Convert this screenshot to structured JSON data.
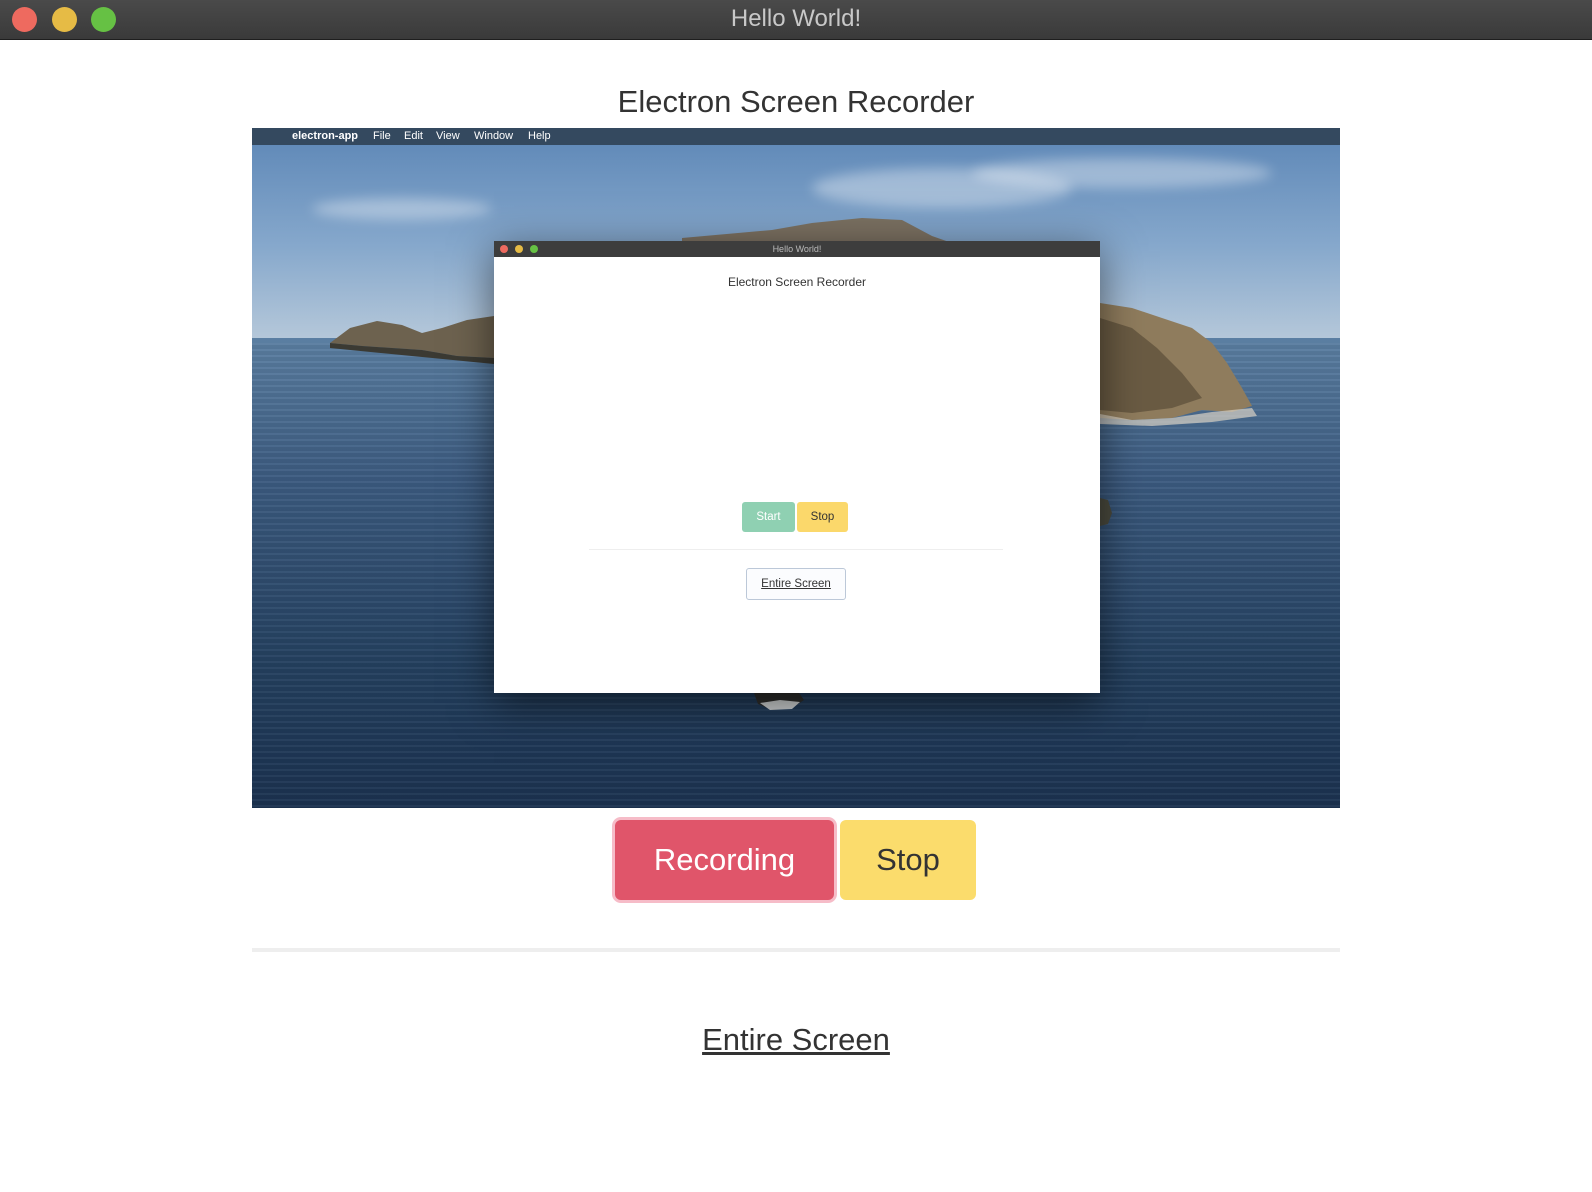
{
  "window": {
    "title": "Hello World!"
  },
  "page": {
    "title": "Electron Screen Recorder"
  },
  "preview": {
    "menubar": {
      "apple_glyph": "",
      "app_name": "electron-app",
      "items": [
        "File",
        "Edit",
        "View",
        "Window",
        "Help"
      ]
    },
    "inner_window": {
      "title": "Hello World!",
      "heading": "Electron Screen Recorder",
      "start_label": "Start",
      "stop_label": "Stop",
      "source_label": "Entire Screen"
    }
  },
  "controls": {
    "record_label": "Recording",
    "stop_label": "Stop"
  },
  "source": {
    "label": "Entire Screen"
  },
  "colors": {
    "recording": "#e0556a",
    "stop": "#fbdc6c",
    "start": "#8fd0b2"
  }
}
